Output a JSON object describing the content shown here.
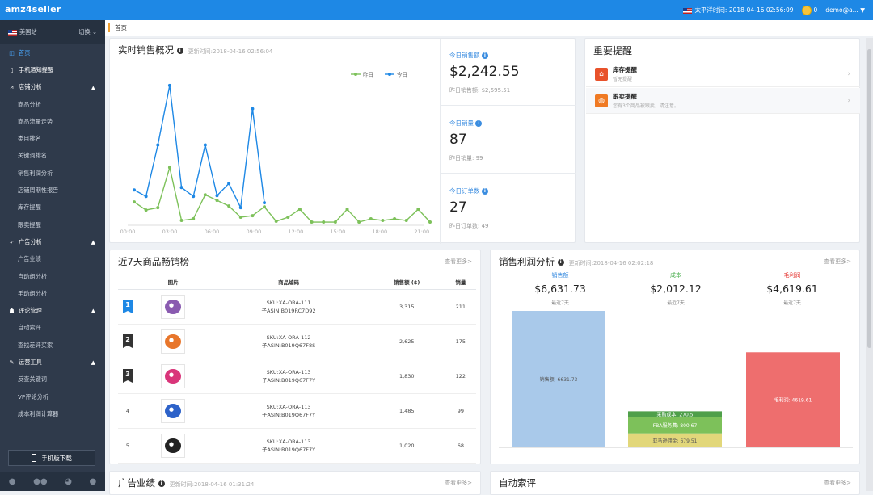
{
  "app": {
    "logo": "amz4seller"
  },
  "topbar": {
    "timezone": "太平洋时间: 2018-04-16 02:56:09",
    "coins": "0",
    "user": "demo@a..."
  },
  "sidebar": {
    "marketplace": "美国站",
    "switch": "切换",
    "items": [
      {
        "label": "首页",
        "type": "active",
        "icon": "◫"
      },
      {
        "label": "手机通知提醒",
        "type": "sec",
        "icon": "▯"
      },
      {
        "label": "店铺分析",
        "type": "sec",
        "icon": "⩘",
        "chev": "▲"
      },
      {
        "label": "商品分析",
        "type": "sub"
      },
      {
        "label": "商品流量走势",
        "type": "sub"
      },
      {
        "label": "类目排名",
        "type": "sub"
      },
      {
        "label": "关键词排名",
        "type": "sub"
      },
      {
        "label": "销售利润分析",
        "type": "sub"
      },
      {
        "label": "店铺周期性报告",
        "type": "sub"
      },
      {
        "label": "库存提醒",
        "type": "sub"
      },
      {
        "label": "跟卖提醒",
        "type": "sub"
      },
      {
        "label": "广告分析",
        "type": "sec",
        "icon": "➶",
        "chev": "▲"
      },
      {
        "label": "广告业绩",
        "type": "sub"
      },
      {
        "label": "自动组分析",
        "type": "sub"
      },
      {
        "label": "手动组分析",
        "type": "sub"
      },
      {
        "label": "评论管理",
        "type": "sec",
        "icon": "☗",
        "chev": "▲"
      },
      {
        "label": "自动索评",
        "type": "sub"
      },
      {
        "label": "查找差评买家",
        "type": "sub"
      },
      {
        "label": "运营工具",
        "type": "sec",
        "icon": "✎",
        "chev": "▲"
      },
      {
        "label": "反查关键词",
        "type": "sub"
      },
      {
        "label": "VP评论分析",
        "type": "sub"
      },
      {
        "label": "成本利润计算器",
        "type": "sub"
      }
    ],
    "download": "手机版下载"
  },
  "breadcrumb": "首页",
  "realtime": {
    "title": "实时销售概况",
    "updated": "更新时间:2018-04-16 02:56:04",
    "legend_yesterday": "昨日",
    "legend_today": "今日"
  },
  "stats": [
    {
      "label": "今日销售额",
      "value": "$2,242.55",
      "yesterday": "昨日销售额: $2,595.51"
    },
    {
      "label": "今日销量",
      "value": "87",
      "yesterday": "昨日销量: 99"
    },
    {
      "label": "今日订单数",
      "value": "27",
      "yesterday": "昨日订单数: 49"
    }
  ],
  "alerts": {
    "title": "重要提醒",
    "items": [
      {
        "title": "库存提醒",
        "desc": "暂无提醒",
        "color": "#e8522b",
        "icon": "⌂"
      },
      {
        "title": "跟卖提醒",
        "desc": "您有3个商品被跟卖，请注意。",
        "color": "#f07a23",
        "icon": "◍"
      }
    ]
  },
  "ranking": {
    "title": "近7天商品畅销榜",
    "more": "查看更多>",
    "headers": [
      "图片",
      "商品编码",
      "销售额 ($)",
      "销量"
    ],
    "rows": [
      {
        "rank": "1",
        "sku": "SKU:XA-ORA-111",
        "asin": "子ASIN:B019RC7D92",
        "sales": "3,315",
        "qty": "211",
        "badge": "#1e88e5",
        "color": "#8a5bb0"
      },
      {
        "rank": "2",
        "sku": "SKU:XA-ORA-112",
        "asin": "子ASIN:B019Q67F8S",
        "sales": "2,625",
        "qty": "175",
        "badge": "#333",
        "color": "#e8762b"
      },
      {
        "rank": "3",
        "sku": "SKU:XA-ORA-113",
        "asin": "子ASIN:B019Q67F7Y",
        "sales": "1,830",
        "qty": "122",
        "badge": "#333",
        "color": "#d9357a"
      },
      {
        "rank": "4",
        "sku": "SKU:XA-ORA-113",
        "asin": "子ASIN:B019Q67F7Y",
        "sales": "1,485",
        "qty": "99",
        "badge": "",
        "color": "#2d62c9"
      },
      {
        "rank": "5",
        "sku": "SKU:XA-ORA-113",
        "asin": "子ASIN:B019Q67F7Y",
        "sales": "1,020",
        "qty": "68",
        "badge": "",
        "color": "#222"
      }
    ]
  },
  "profit": {
    "title": "销售利润分析",
    "updated": "更新时间:2018-04-16 02:02:18",
    "more": "查看更多>",
    "cols": [
      {
        "label": "销售额",
        "value": "$6,631.73",
        "sub": "最近7天",
        "color": "#3b8de0"
      },
      {
        "label": "成本",
        "value": "$2,012.12",
        "sub": "最近7天",
        "color": "#4caf50"
      },
      {
        "label": "毛利润",
        "value": "$4,619.61",
        "sub": "最近7天",
        "color": "#e53935"
      }
    ],
    "bars": {
      "sales": "销售额: 6631.73",
      "purchase": "采购成本: 270.5",
      "fba": "FBA服务费: 800.67",
      "amazon": "亚马逊佣金: 679.51",
      "gross": "毛利润: 4619.61"
    }
  },
  "ads": {
    "title": "广告业绩",
    "updated": "更新时间:2018-04-16 01:31:24",
    "more": "查看更多>"
  },
  "review": {
    "title": "自动索评",
    "more": "查看更多>"
  },
  "chart_data": {
    "type": "line",
    "x": [
      "00:00",
      "03:00",
      "06:00",
      "09:00",
      "12:00",
      "15:00",
      "18:00",
      "21:00"
    ],
    "series": [
      {
        "name": "昨日",
        "color": "#7dc15a",
        "values": [
          290,
          190,
          220,
          720,
          60,
          80,
          380,
          310,
          240,
          100,
          120,
          230,
          50,
          100,
          200,
          40,
          40,
          40,
          200,
          40,
          80,
          60,
          80,
          60,
          200,
          40
        ]
      },
      {
        "name": "今日",
        "color": "#1e88e5",
        "values": [
          440,
          360,
          1000,
          1740,
          470,
          360,
          1000,
          370,
          520,
          220,
          1450,
          280
        ]
      }
    ]
  }
}
